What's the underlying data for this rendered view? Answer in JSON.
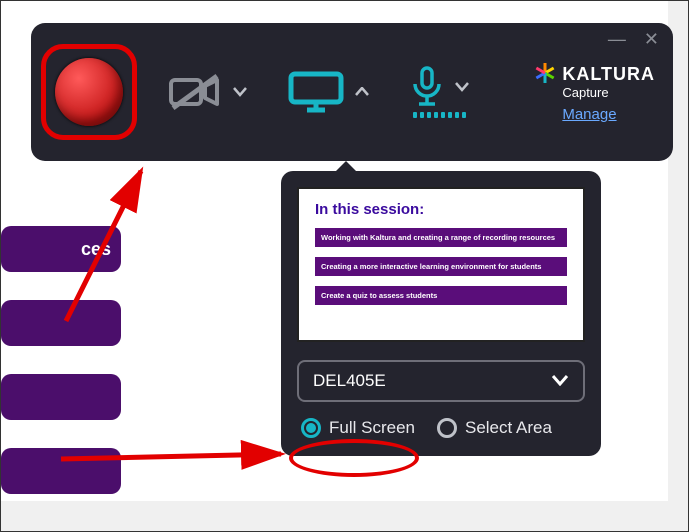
{
  "background": {
    "partial_text": "ces"
  },
  "topbar": {
    "window_controls": {
      "minimize": "—",
      "close": "✕"
    },
    "camera": {
      "state": "off"
    },
    "screen": {
      "state": "on"
    },
    "mic": {
      "state": "on"
    },
    "brand": {
      "name": "KALTURA",
      "sub": "Capture",
      "manage": "Manage"
    }
  },
  "panel": {
    "preview": {
      "title": "In this session:",
      "bullets": [
        "Working with Kaltura and creating a range of recording resources",
        "Creating a more interactive learning environment for students",
        "Create a quiz to assess students"
      ]
    },
    "source_select": {
      "value": "DEL405E"
    },
    "modes": {
      "full_screen": "Full Screen",
      "select_area": "Select Area",
      "selected": "full_screen"
    }
  }
}
